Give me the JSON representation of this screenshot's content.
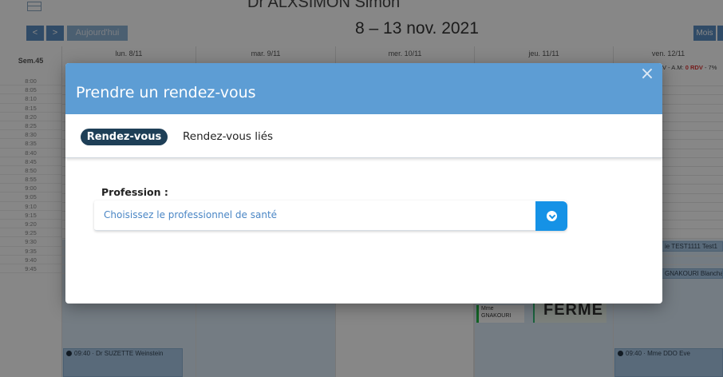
{
  "calendar": {
    "doctor_name": "Dr ALXSIMON Simon",
    "nav_prev": "<",
    "nav_next": ">",
    "today_label": "Aujourd'hui",
    "range_title": "8 – 13 nov. 2021",
    "view_month_label": "Mois",
    "week_label": "Sem.45",
    "days": [
      {
        "label": "lun. 8/11"
      },
      {
        "label": "mar. 9/11"
      },
      {
        "label": "mer. 10/11"
      },
      {
        "label": "jeu. 11/11"
      },
      {
        "label": "ven. 12/11"
      }
    ],
    "times": [
      "8:00",
      "8:05",
      "8:10",
      "8:15",
      "8:20",
      "8:25",
      "8:30",
      "8:35",
      "8:40",
      "8:45",
      "8:50",
      "8:55",
      "9:00",
      "9:05",
      "9:10",
      "9:15",
      "9:20",
      "9:25",
      "9:30",
      "9:35",
      "9:40",
      "9:45"
    ],
    "ven_stats_prefix": "V - A.M: ",
    "ven_stats_rdv": "0 RDV",
    "ven_stats_suffix": " - 7%",
    "appointments": [
      {
        "text": "09:40 · Dr SUZETTE Weinstein"
      },
      {
        "text": "09:40 · Mme DDO Eve"
      },
      {
        "text": "ie TEST1111 Test1"
      },
      {
        "text": "GNAKOURI Blancha"
      }
    ],
    "ferme_label": "FERME",
    "mme_tag_line1": "Mme",
    "mme_tag_line2": "GNAKOURI"
  },
  "modal": {
    "title": "Prendre un rendez-vous",
    "close_label": "×",
    "tabs": [
      {
        "label": "Rendez-vous",
        "active": true
      },
      {
        "label": "Rendez-vous liés",
        "active": false
      }
    ],
    "profession_label": "Profession :",
    "profession_placeholder": "Choisissez le professionnel de santé"
  },
  "colors": {
    "header_blue": "#5d9dd4",
    "tab_active_bg": "#1e3f57",
    "select_button": "#1592e6",
    "placeholder_text": "#4a86c5"
  }
}
